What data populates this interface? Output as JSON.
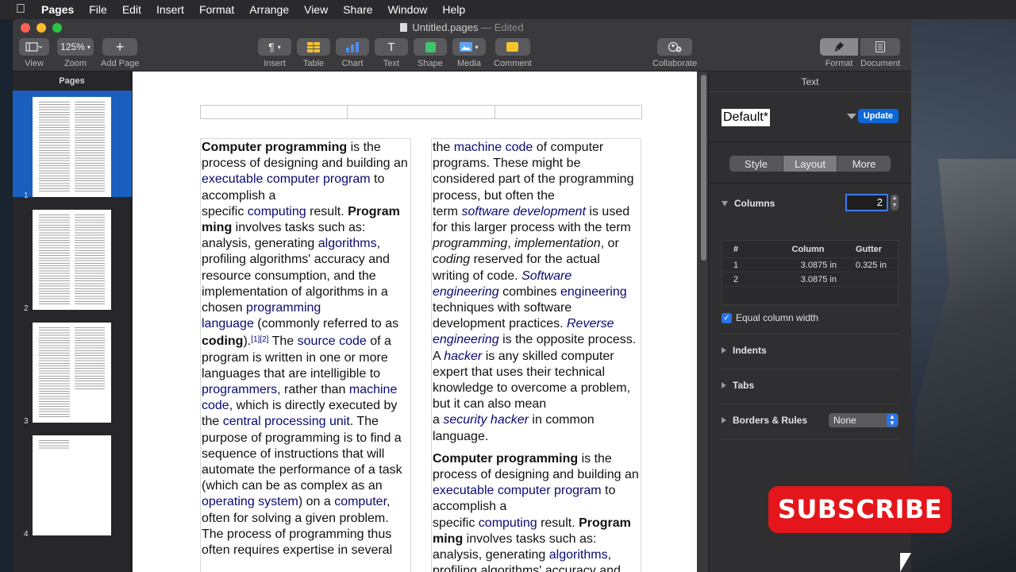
{
  "menubar": {
    "apple": "",
    "app": "Pages",
    "items": [
      "File",
      "Edit",
      "Insert",
      "Format",
      "Arrange",
      "View",
      "Share",
      "Window",
      "Help"
    ]
  },
  "window": {
    "doc_name": "Untitled.pages",
    "edited": "— Edited"
  },
  "toolbar": {
    "view": "View",
    "zoom_value": "125%",
    "zoom": "Zoom",
    "add_page": "Add Page",
    "insert": "Insert",
    "table": "Table",
    "chart": "Chart",
    "text": "Text",
    "shape": "Shape",
    "media": "Media",
    "comment": "Comment",
    "collaborate": "Collaborate",
    "format": "Format",
    "document": "Document"
  },
  "sidebar": {
    "title": "Pages",
    "pages": [
      "1",
      "2",
      "3",
      "4"
    ],
    "selected_page": "1"
  },
  "inspector": {
    "header": "Text",
    "style_name": "Default*",
    "update": "Update",
    "tabs": [
      "Style",
      "Layout",
      "More"
    ],
    "active_tab": "Layout",
    "columns_label": "Columns",
    "columns_count": "2",
    "table_headers": [
      "#",
      "Column",
      "Gutter"
    ],
    "table_rows": [
      {
        "num": "1",
        "column": "3.0875 in",
        "gutter": "0.325 in"
      },
      {
        "num": "2",
        "column": "3.0875 in",
        "gutter": ""
      }
    ],
    "equal_width": "Equal column width",
    "indents": "Indents",
    "tabs_section": "Tabs",
    "borders": "Borders & Rules",
    "borders_value": "None"
  },
  "overlay": {
    "subscribe": "SUBSCRIBE"
  },
  "colors": {
    "accent": "#0d67d6",
    "link": "#0a0a73",
    "subscribe": "#e4161b"
  }
}
